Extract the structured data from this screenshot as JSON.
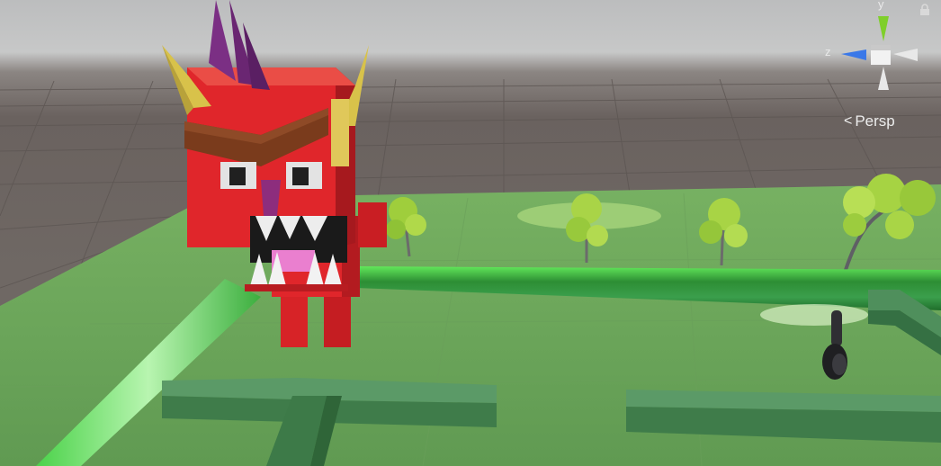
{
  "scene_view": {
    "projection_label": "Persp",
    "gizmo": {
      "y_label": "y",
      "z_label": "z",
      "colors": {
        "y": "#7fcf2b",
        "z": "#3a78e8",
        "x": "#e8e8e8"
      }
    },
    "icons": [
      "perspective-chevron-icon",
      "lock-icon",
      "orientation-gizmo-icon"
    ]
  },
  "scene_objects": {
    "character": "devil-character",
    "trees": 4,
    "colors": {
      "ground": "#6aa55a",
      "wall": "#4f8a5a",
      "devil": "#e0262b",
      "horn": "#d8c24a"
    }
  }
}
